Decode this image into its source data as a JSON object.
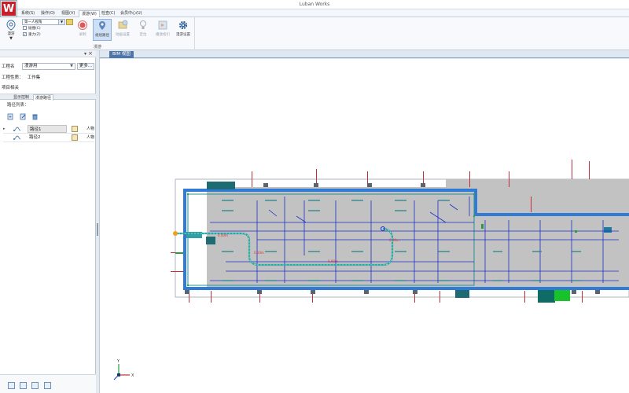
{
  "app": {
    "title": "Luban Works",
    "logo_letter": "W"
  },
  "menu": {
    "tabs": [
      "系统(S)",
      "操作(O)",
      "视图(V)",
      "漫游(W)",
      "检查(C)",
      "会员中心(U)"
    ],
    "active": "漫游(W)"
  },
  "ribbon": {
    "tour_label": "漫游",
    "view_mode": "第一人视角",
    "checkboxes": [
      {
        "label": "碰撞(C)",
        "checked": false
      },
      {
        "label": "重力(Z)",
        "checked": true
      }
    ],
    "buttons": [
      {
        "label": "录制",
        "icon": "record-icon",
        "state": "disabled"
      },
      {
        "label": "规划路径",
        "icon": "plan-path-icon",
        "state": "selected"
      },
      {
        "label": "动画设置",
        "icon": "animation-settings-icon",
        "state": "disabled"
      },
      {
        "label": "定位",
        "icon": "locate-icon",
        "state": "disabled"
      },
      {
        "label": "播放指引",
        "icon": "play-guide-icon",
        "state": "disabled"
      },
      {
        "label": "漫游设置",
        "icon": "gear-icon",
        "state": "enabled"
      }
    ],
    "group_label": "漫游"
  },
  "left_panel": {
    "project_name_label": "工程名",
    "project_name_value": "漫游用",
    "more_label": "更多...",
    "project_type_label": "工程性质：",
    "project_type_value": "工作集",
    "project_related_label": "项目相关",
    "subtabs": [
      "显示控制",
      "漫游路径"
    ],
    "active_subtab": "漫游路径",
    "path_list_label": "路径列表：",
    "tool_icons": [
      "new-path-icon",
      "edit-path-icon",
      "delete-path-icon"
    ],
    "paths": [
      {
        "name": "路径1",
        "extra": "人物",
        "selected": true
      },
      {
        "name": "路径2",
        "extra": "人物",
        "selected": false
      }
    ],
    "bottom_icons": [
      "play-icon",
      "record-icon",
      "stop-icon",
      "export-icon"
    ]
  },
  "document": {
    "tab_label": "BIM 视图",
    "path_labels": [
      "0.00m",
      "0.00m",
      "0.00m",
      "0.00m"
    ],
    "axis_labels": {
      "x": "X",
      "y": "Y"
    }
  },
  "colors": {
    "accent": "#4e77a8",
    "floor_gray": "#c2c2c2",
    "wall_blue": "#2f7bd6",
    "pipe_dark_blue": "#1a2ec7",
    "path_teal": "#2aa5a0",
    "logo_red": "#c8202a"
  }
}
